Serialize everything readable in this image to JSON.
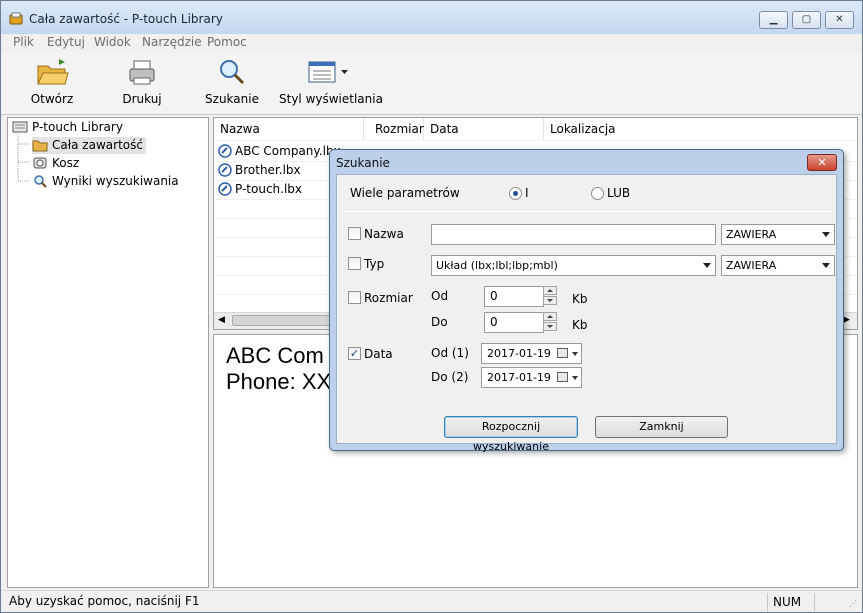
{
  "window": {
    "title": "Cała zawartość - P-touch Library"
  },
  "menu": [
    "Plik",
    "Edytuj",
    "Widok",
    "Narzędzie",
    "Pomoc"
  ],
  "toolbar": {
    "open": "Otwórz",
    "print": "Drukuj",
    "search": "Szukanie",
    "view_style": "Styl wyświetlania"
  },
  "tree": {
    "root": "P-touch Library",
    "items": [
      "Cała zawartość",
      "Kosz",
      "Wyniki wyszukiwania"
    ]
  },
  "list": {
    "columns": [
      "Nazwa",
      "Rozmiar",
      "Data",
      "Lokalizacja"
    ],
    "rows": [
      {
        "name": "ABC Company.lbx"
      },
      {
        "name": "Brother.lbx"
      },
      {
        "name": "P-touch.lbx"
      }
    ]
  },
  "preview": {
    "lines": [
      "ABC Com",
      "Phone: XX"
    ]
  },
  "status": {
    "help": "Aby uzyskać pomoc, naciśnij F1",
    "num": "NUM"
  },
  "dialog": {
    "title": "Szukanie",
    "close": "✕",
    "multi_params_label": "Wiele parametrów",
    "radio_and": "I",
    "radio_or": "LUB",
    "name_label": "Nazwa",
    "name_value": "",
    "name_op": "ZAWIERA",
    "type_label": "Typ",
    "type_value": "Układ (lbx;lbl;lbp;mbl)",
    "type_op": "ZAWIERA",
    "size_label": "Rozmiar",
    "from_label": "Od",
    "to_label": "Do",
    "size_from": "0",
    "size_to": "0",
    "unit": "Kb",
    "date_label": "Data",
    "date_from_label": "Od (1)",
    "date_to_label": "Do (2)",
    "date_from": "2017-01-19",
    "date_to": "2017-01-19",
    "checks": {
      "name": false,
      "type": false,
      "size": false,
      "date": true
    },
    "start_button": "Rozpocznij wyszukiwanie",
    "close_button": "Zamknij"
  }
}
